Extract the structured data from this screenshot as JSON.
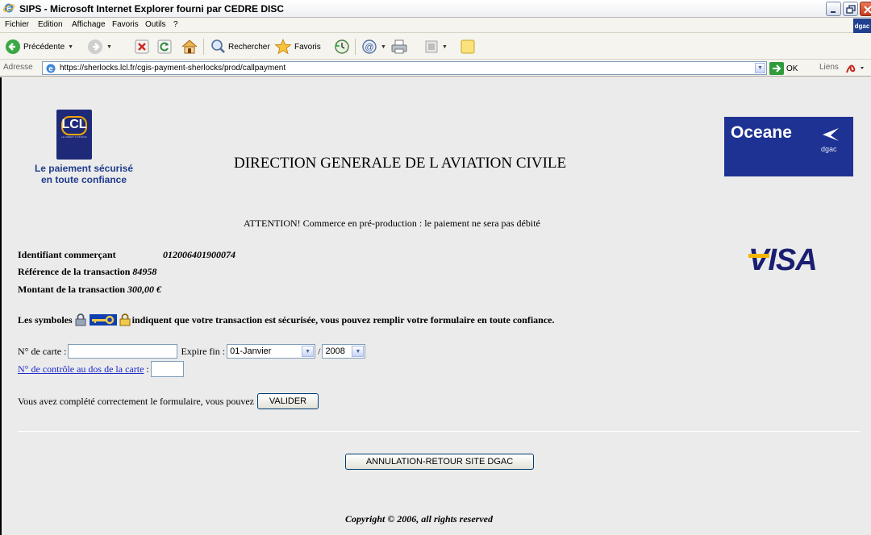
{
  "window": {
    "title": "SIPS - Microsoft Internet Explorer fourni par CEDRE DISC",
    "badge": "dgac"
  },
  "menubar": {
    "items": [
      "Fichier",
      "Edition",
      "Affichage",
      "Favoris",
      "Outils",
      "?"
    ]
  },
  "toolbar": {
    "back_label": "Précédente",
    "search_label": "Rechercher",
    "favorites_label": "Favoris"
  },
  "address_bar": {
    "label": "Adresse",
    "url": "https://sherlocks.lcl.fr/cgis-payment-sherlocks/prod/callpayment",
    "go_label": "OK",
    "links_label": "Liens"
  },
  "page": {
    "lcl_logo_text": "LCL",
    "lcl_logo_subtext": "LE CRÉDIT LYONNAIS",
    "lcl_tagline_1": "Le paiement sécurisé",
    "lcl_tagline_2": "en toute confiance",
    "organization_title": "DIRECTION GENERALE DE L AVIATION CIVILE",
    "oceane_logo_name": "Oceane",
    "oceane_logo_sub": "dgac",
    "warning": "ATTENTION! Commerce en pré-production : le paiement ne sera pas débité",
    "merchant_label": "Identifiant commerçant",
    "merchant_value": "012006401900074",
    "reference_label": "Référence de la transaction",
    "reference_value": "84958",
    "amount_label": "Montant de la transaction",
    "amount_value": "300,00 €",
    "visa_logo": "VISA",
    "security_prefix": "Les symboles",
    "security_suffix": "indiquent que votre transaction est sécurisée, vous pouvez remplir votre formulaire en toute confiance."
  },
  "form": {
    "card_label": "N° de carte :",
    "card_value": "",
    "expire_label": "Expire fin :",
    "month_selected": "01-Janvier",
    "year_separator": "/",
    "year_selected": "2008",
    "cvv_link": "N° de contrôle au dos de la carte",
    "cvv_colon": ":",
    "cvv_value": "",
    "submit_prompt": "Vous avez complété correctement le formulaire, vous pouvez",
    "submit_label": "VALIDER",
    "cancel_label": "ANNULATION-RETOUR SITE DGAC"
  },
  "footer": {
    "copyright": "Copyright © 2006, all rights reserved"
  }
}
